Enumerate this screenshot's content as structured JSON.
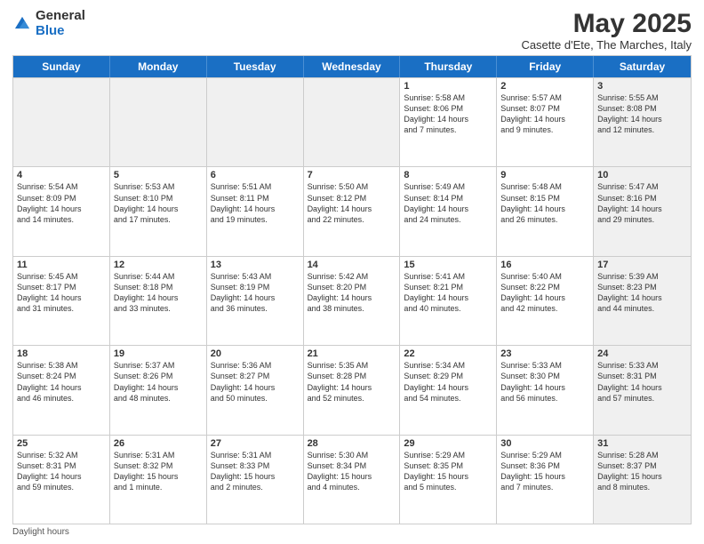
{
  "logo": {
    "general": "General",
    "blue": "Blue"
  },
  "header": {
    "month_title": "May 2025",
    "location": "Casette d'Ete, The Marches, Italy"
  },
  "days_of_week": [
    "Sunday",
    "Monday",
    "Tuesday",
    "Wednesday",
    "Thursday",
    "Friday",
    "Saturday"
  ],
  "weeks": [
    [
      {
        "day": "",
        "info": "",
        "shaded": true
      },
      {
        "day": "",
        "info": "",
        "shaded": true
      },
      {
        "day": "",
        "info": "",
        "shaded": true
      },
      {
        "day": "",
        "info": "",
        "shaded": true
      },
      {
        "day": "1",
        "info": "Sunrise: 5:58 AM\nSunset: 8:06 PM\nDaylight: 14 hours\nand 7 minutes.",
        "shaded": false
      },
      {
        "day": "2",
        "info": "Sunrise: 5:57 AM\nSunset: 8:07 PM\nDaylight: 14 hours\nand 9 minutes.",
        "shaded": false
      },
      {
        "day": "3",
        "info": "Sunrise: 5:55 AM\nSunset: 8:08 PM\nDaylight: 14 hours\nand 12 minutes.",
        "shaded": true
      }
    ],
    [
      {
        "day": "4",
        "info": "Sunrise: 5:54 AM\nSunset: 8:09 PM\nDaylight: 14 hours\nand 14 minutes.",
        "shaded": false
      },
      {
        "day": "5",
        "info": "Sunrise: 5:53 AM\nSunset: 8:10 PM\nDaylight: 14 hours\nand 17 minutes.",
        "shaded": false
      },
      {
        "day": "6",
        "info": "Sunrise: 5:51 AM\nSunset: 8:11 PM\nDaylight: 14 hours\nand 19 minutes.",
        "shaded": false
      },
      {
        "day": "7",
        "info": "Sunrise: 5:50 AM\nSunset: 8:12 PM\nDaylight: 14 hours\nand 22 minutes.",
        "shaded": false
      },
      {
        "day": "8",
        "info": "Sunrise: 5:49 AM\nSunset: 8:14 PM\nDaylight: 14 hours\nand 24 minutes.",
        "shaded": false
      },
      {
        "day": "9",
        "info": "Sunrise: 5:48 AM\nSunset: 8:15 PM\nDaylight: 14 hours\nand 26 minutes.",
        "shaded": false
      },
      {
        "day": "10",
        "info": "Sunrise: 5:47 AM\nSunset: 8:16 PM\nDaylight: 14 hours\nand 29 minutes.",
        "shaded": true
      }
    ],
    [
      {
        "day": "11",
        "info": "Sunrise: 5:45 AM\nSunset: 8:17 PM\nDaylight: 14 hours\nand 31 minutes.",
        "shaded": false
      },
      {
        "day": "12",
        "info": "Sunrise: 5:44 AM\nSunset: 8:18 PM\nDaylight: 14 hours\nand 33 minutes.",
        "shaded": false
      },
      {
        "day": "13",
        "info": "Sunrise: 5:43 AM\nSunset: 8:19 PM\nDaylight: 14 hours\nand 36 minutes.",
        "shaded": false
      },
      {
        "day": "14",
        "info": "Sunrise: 5:42 AM\nSunset: 8:20 PM\nDaylight: 14 hours\nand 38 minutes.",
        "shaded": false
      },
      {
        "day": "15",
        "info": "Sunrise: 5:41 AM\nSunset: 8:21 PM\nDaylight: 14 hours\nand 40 minutes.",
        "shaded": false
      },
      {
        "day": "16",
        "info": "Sunrise: 5:40 AM\nSunset: 8:22 PM\nDaylight: 14 hours\nand 42 minutes.",
        "shaded": false
      },
      {
        "day": "17",
        "info": "Sunrise: 5:39 AM\nSunset: 8:23 PM\nDaylight: 14 hours\nand 44 minutes.",
        "shaded": true
      }
    ],
    [
      {
        "day": "18",
        "info": "Sunrise: 5:38 AM\nSunset: 8:24 PM\nDaylight: 14 hours\nand 46 minutes.",
        "shaded": false
      },
      {
        "day": "19",
        "info": "Sunrise: 5:37 AM\nSunset: 8:26 PM\nDaylight: 14 hours\nand 48 minutes.",
        "shaded": false
      },
      {
        "day": "20",
        "info": "Sunrise: 5:36 AM\nSunset: 8:27 PM\nDaylight: 14 hours\nand 50 minutes.",
        "shaded": false
      },
      {
        "day": "21",
        "info": "Sunrise: 5:35 AM\nSunset: 8:28 PM\nDaylight: 14 hours\nand 52 minutes.",
        "shaded": false
      },
      {
        "day": "22",
        "info": "Sunrise: 5:34 AM\nSunset: 8:29 PM\nDaylight: 14 hours\nand 54 minutes.",
        "shaded": false
      },
      {
        "day": "23",
        "info": "Sunrise: 5:33 AM\nSunset: 8:30 PM\nDaylight: 14 hours\nand 56 minutes.",
        "shaded": false
      },
      {
        "day": "24",
        "info": "Sunrise: 5:33 AM\nSunset: 8:31 PM\nDaylight: 14 hours\nand 57 minutes.",
        "shaded": true
      }
    ],
    [
      {
        "day": "25",
        "info": "Sunrise: 5:32 AM\nSunset: 8:31 PM\nDaylight: 14 hours\nand 59 minutes.",
        "shaded": false
      },
      {
        "day": "26",
        "info": "Sunrise: 5:31 AM\nSunset: 8:32 PM\nDaylight: 15 hours\nand 1 minute.",
        "shaded": false
      },
      {
        "day": "27",
        "info": "Sunrise: 5:31 AM\nSunset: 8:33 PM\nDaylight: 15 hours\nand 2 minutes.",
        "shaded": false
      },
      {
        "day": "28",
        "info": "Sunrise: 5:30 AM\nSunset: 8:34 PM\nDaylight: 15 hours\nand 4 minutes.",
        "shaded": false
      },
      {
        "day": "29",
        "info": "Sunrise: 5:29 AM\nSunset: 8:35 PM\nDaylight: 15 hours\nand 5 minutes.",
        "shaded": false
      },
      {
        "day": "30",
        "info": "Sunrise: 5:29 AM\nSunset: 8:36 PM\nDaylight: 15 hours\nand 7 minutes.",
        "shaded": false
      },
      {
        "day": "31",
        "info": "Sunrise: 5:28 AM\nSunset: 8:37 PM\nDaylight: 15 hours\nand 8 minutes.",
        "shaded": true
      }
    ]
  ],
  "footer": {
    "note": "Daylight hours"
  }
}
